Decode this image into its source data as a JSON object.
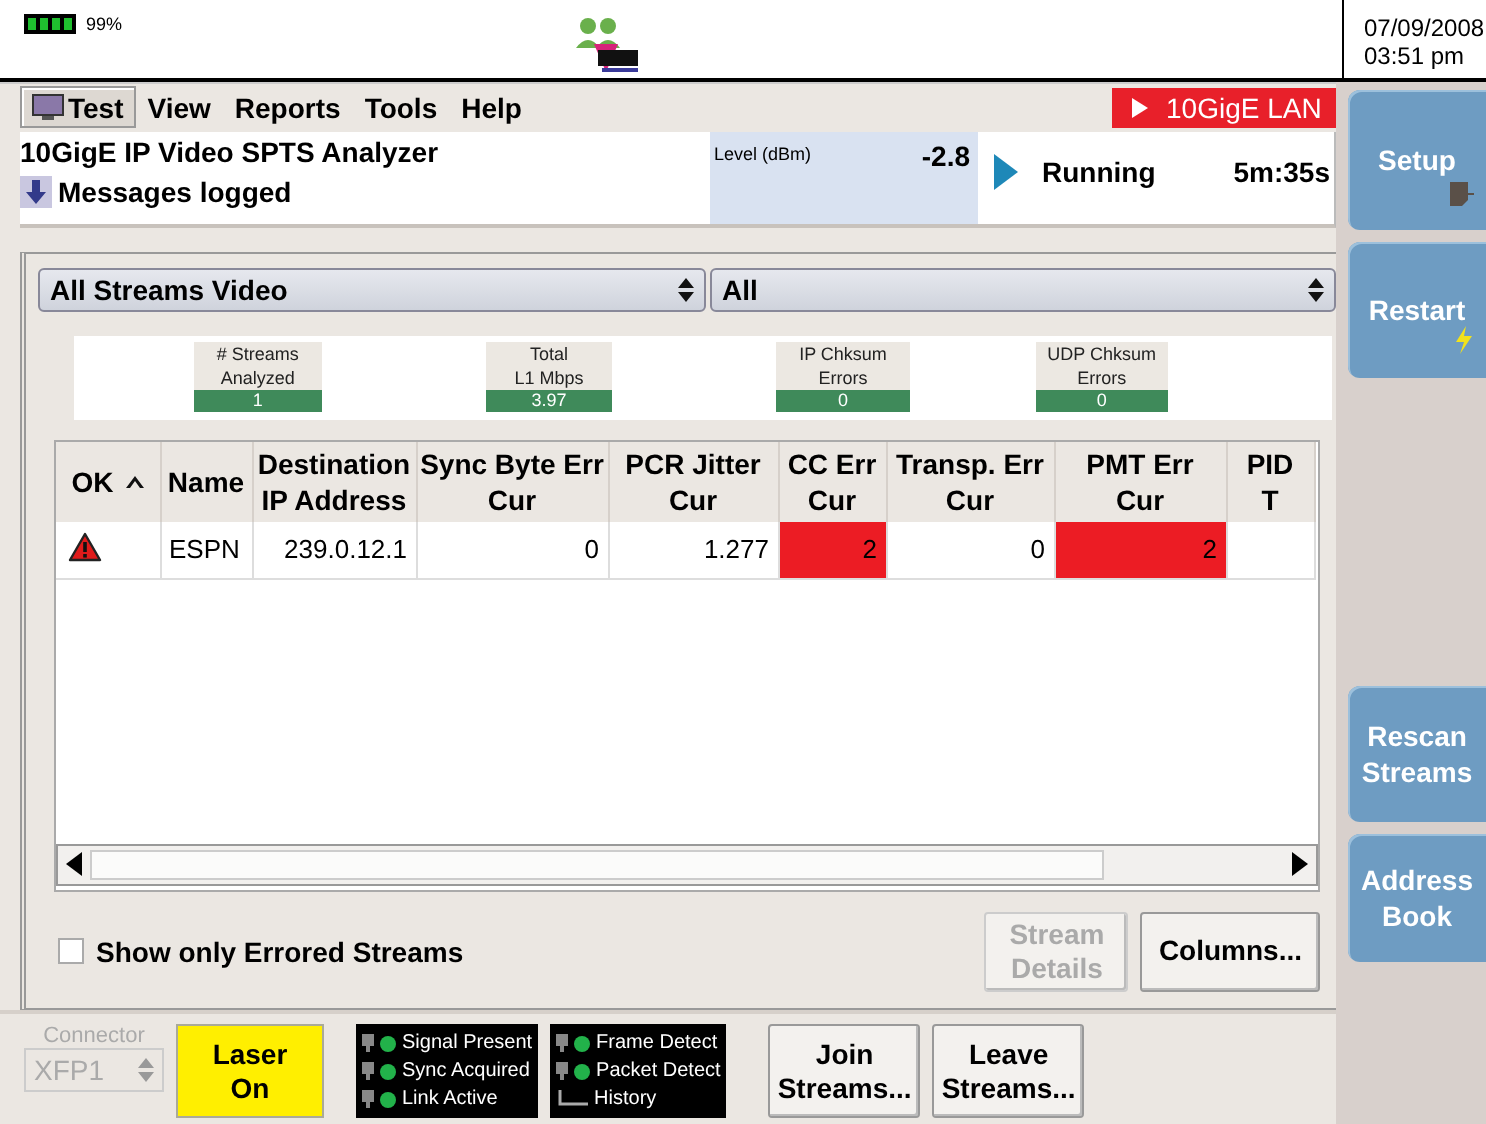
{
  "status_bar": {
    "battery": "99%",
    "date": "07/09/2008",
    "time": "03:51 pm"
  },
  "menu": [
    {
      "label": "Test",
      "selected": true
    },
    {
      "label": "View",
      "selected": false
    },
    {
      "label": "Reports",
      "selected": false
    },
    {
      "label": "Tools",
      "selected": false
    },
    {
      "label": "Help",
      "selected": false
    }
  ],
  "interface_badge": "10GigE LAN",
  "info": {
    "title": "10GigE IP Video SPTS Analyzer",
    "messages": "Messages logged",
    "level_label": "Level (dBm)",
    "level_value": "-2.8",
    "status": "Running",
    "elapsed": "5m:35s"
  },
  "filters": [
    "All Streams Video",
    "All"
  ],
  "stats": [
    {
      "lines": [
        "# Streams",
        "Analyzed"
      ],
      "value": "1"
    },
    {
      "lines": [
        "Total",
        "L1 Mbps"
      ],
      "value": "3.97"
    },
    {
      "lines": [
        "IP Chksum",
        "Errors"
      ],
      "value": "0"
    },
    {
      "lines": [
        "UDP Chksum",
        "Errors"
      ],
      "value": "0"
    }
  ],
  "table": {
    "columns": [
      {
        "lines": [
          "OK"
        ],
        "sorted": true
      },
      {
        "lines": [
          "Name"
        ],
        "sorted": false
      },
      {
        "lines": [
          "Destination",
          "IP Address"
        ],
        "sorted": false
      },
      {
        "lines": [
          "Sync Byte Err",
          "Cur"
        ],
        "sorted": false
      },
      {
        "lines": [
          "PCR Jitter",
          "Cur"
        ],
        "sorted": false
      },
      {
        "lines": [
          "CC Err",
          "Cur"
        ],
        "sorted": false
      },
      {
        "lines": [
          "Transp. Err",
          "Cur"
        ],
        "sorted": false
      },
      {
        "lines": [
          "PMT Err",
          "Cur"
        ],
        "sorted": false
      },
      {
        "lines": [
          "PID",
          "T"
        ],
        "sorted": false
      }
    ],
    "rows": [
      {
        "cells": [
          {
            "kind": "warning"
          },
          {
            "kind": "text",
            "text": "ESPN",
            "alarm": false
          },
          {
            "kind": "text",
            "text": "239.0.12.1",
            "alarm": false
          },
          {
            "kind": "text",
            "text": "0",
            "alarm": false
          },
          {
            "kind": "text",
            "text": "1.277",
            "alarm": false
          },
          {
            "kind": "text",
            "text": "2",
            "alarm": true
          },
          {
            "kind": "text",
            "text": "0",
            "alarm": false
          },
          {
            "kind": "text",
            "text": "2",
            "alarm": true
          }
        ]
      }
    ]
  },
  "show_errored": {
    "label": "Show only Errored Streams",
    "checked": false
  },
  "panel_buttons": [
    {
      "label": "Stream Details",
      "disabled": true
    },
    {
      "label": "Columns...",
      "disabled": false
    }
  ],
  "connector": {
    "label": "Connector",
    "value": "XFP1",
    "disabled": true
  },
  "laser_button": "Laser On",
  "led_panels": [
    [
      {
        "label": "Signal Present",
        "kind": "led",
        "lit": true
      },
      {
        "label": "Sync Acquired",
        "kind": "led",
        "lit": true
      },
      {
        "label": "Link Active",
        "kind": "led",
        "lit": true
      }
    ],
    [
      {
        "label": "Frame Detect",
        "kind": "led",
        "lit": true
      },
      {
        "label": "Packet Detect",
        "kind": "led",
        "lit": true
      },
      {
        "label": "History",
        "kind": "history"
      }
    ]
  ],
  "bottom_buttons": [
    "Join Streams...",
    "Leave Streams..."
  ],
  "side_buttons": [
    "Setup",
    "Restart",
    "Rescan Streams",
    "Address Book"
  ]
}
